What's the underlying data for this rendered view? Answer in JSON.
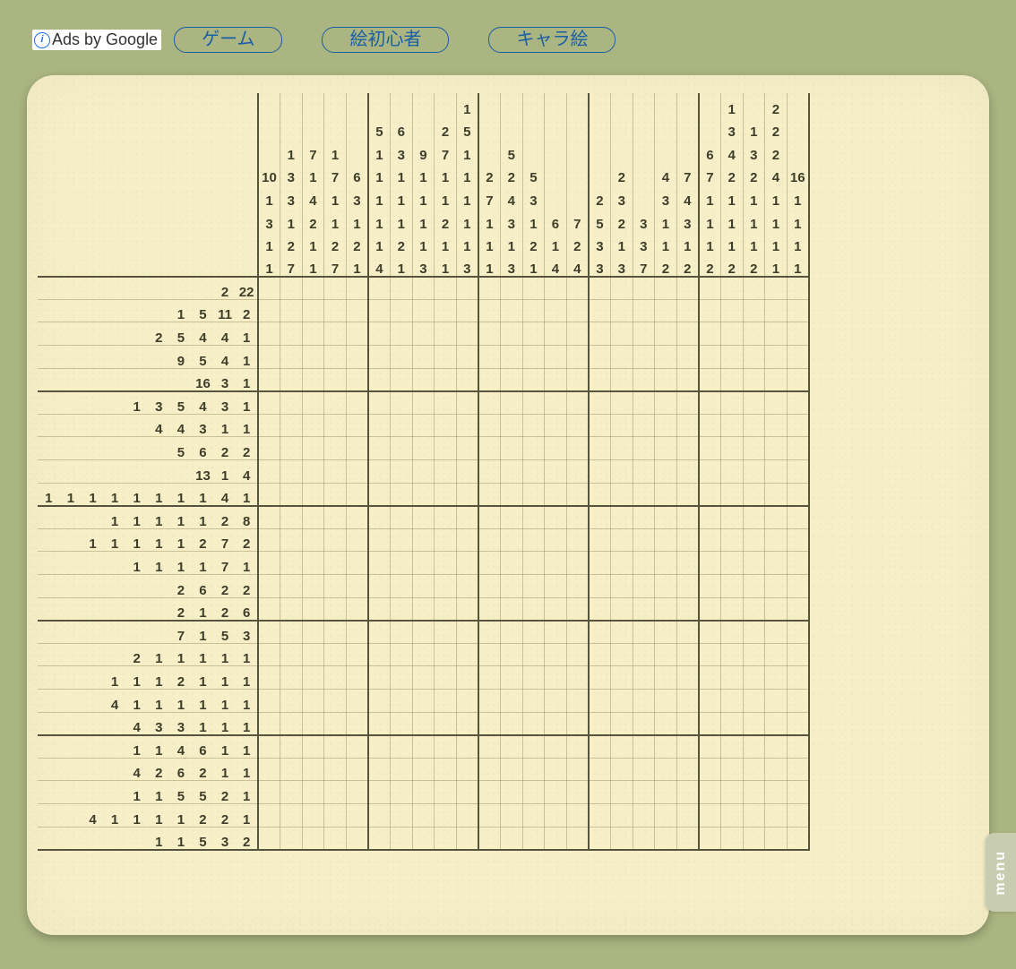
{
  "ads": {
    "label": "Ads by Google",
    "links": [
      "ゲーム",
      "絵初心者",
      "キャラ絵"
    ]
  },
  "menu_label": "menu",
  "nonogram": {
    "cols": 27,
    "rows": 25,
    "row_hint_slots": 10,
    "col_hint_slots": 8,
    "column_hints": [
      [
        10,
        1,
        3,
        1,
        1
      ],
      [
        1,
        3,
        3,
        1,
        2,
        7
      ],
      [
        7,
        1,
        4,
        2,
        1,
        1
      ],
      [
        1,
        7,
        1,
        1,
        2,
        7
      ],
      [
        6,
        3,
        1,
        2,
        1
      ],
      [
        5,
        1,
        1,
        1,
        1,
        1,
        4
      ],
      [
        6,
        3,
        1,
        1,
        1,
        2,
        1
      ],
      [
        9,
        1,
        1,
        1,
        1,
        3
      ],
      [
        2,
        7,
        1,
        1,
        2,
        1,
        1
      ],
      [
        1,
        5,
        1,
        1,
        1,
        1,
        1,
        3
      ],
      [
        2,
        7,
        1,
        1,
        1
      ],
      [
        5,
        2,
        4,
        3,
        1,
        3
      ],
      [
        5,
        3,
        1,
        2,
        1
      ],
      [
        6,
        1,
        4
      ],
      [
        7,
        2,
        4
      ],
      [
        2,
        5,
        3,
        3
      ],
      [
        2,
        3,
        2,
        1,
        3
      ],
      [
        3,
        3,
        7
      ],
      [
        4,
        3,
        1,
        1,
        2
      ],
      [
        7,
        4,
        3,
        1,
        2
      ],
      [
        6,
        7,
        1,
        1,
        1,
        2
      ],
      [
        1,
        3,
        4,
        2,
        1,
        1,
        1,
        2
      ],
      [
        1,
        3,
        2,
        1,
        1,
        1,
        2
      ],
      [
        2,
        2,
        2,
        4,
        1,
        1,
        1,
        1
      ],
      [
        16,
        1,
        1,
        1,
        1
      ]
    ],
    "row_hints": [
      [
        2,
        22
      ],
      [
        1,
        5,
        11,
        2
      ],
      [
        2,
        5,
        4,
        4,
        1
      ],
      [
        9,
        5,
        4,
        1
      ],
      [
        16,
        3,
        1
      ],
      [
        1,
        3,
        5,
        4,
        3,
        1
      ],
      [
        4,
        4,
        3,
        1,
        1
      ],
      [
        5,
        6,
        2,
        2
      ],
      [
        13,
        1,
        4
      ],
      [
        1,
        1,
        1,
        1,
        1,
        1,
        1,
        1,
        4,
        1
      ],
      [
        1,
        1,
        1,
        1,
        1,
        2,
        8
      ],
      [
        1,
        1,
        1,
        1,
        1,
        2,
        7,
        2
      ],
      [
        1,
        1,
        1,
        1,
        7,
        1
      ],
      [
        2,
        6,
        2,
        2
      ],
      [
        2,
        1,
        2,
        6
      ],
      [
        7,
        1,
        5,
        3
      ],
      [
        2,
        1,
        1,
        1,
        1,
        1
      ],
      [
        1,
        1,
        1,
        2,
        1,
        1,
        1
      ],
      [
        4,
        1,
        1,
        1,
        1,
        1,
        1
      ],
      [
        4,
        3,
        3,
        1,
        1,
        1
      ],
      [
        1,
        1,
        4,
        6,
        1,
        1
      ],
      [
        4,
        2,
        6,
        2,
        1,
        1
      ],
      [
        1,
        1,
        5,
        5,
        2,
        1
      ],
      [
        4,
        1,
        1,
        1,
        1,
        2,
        2,
        1
      ],
      [
        1,
        1,
        5,
        3,
        2
      ]
    ]
  }
}
